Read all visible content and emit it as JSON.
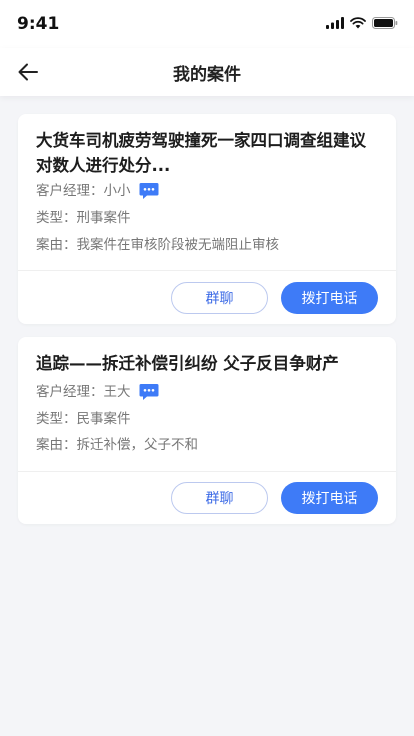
{
  "status_bar": {
    "time": "9:41",
    "icons": [
      "signal-icon",
      "wifi-icon",
      "battery-icon"
    ]
  },
  "nav": {
    "title": "我的案件",
    "back_icon": "arrow-left-icon"
  },
  "cases": [
    {
      "title": "大货车司机疲劳驾驶撞死一家四口调查组建议对数人进行处分...",
      "manager": "客户经理：小小",
      "type": "类型：刑事案件",
      "reason": "案由：我案件在审核阶段被无端阻止审核",
      "group_chat_label": "群聊",
      "call_label": "拨打电话"
    },
    {
      "title": "追踪——拆迁补偿引纠纷 父子反目争财产",
      "manager": "客户经理：王大",
      "type": "类型：民事案件",
      "reason": "案由：拆迁补偿，父子不和",
      "group_chat_label": "群聊",
      "call_label": "拨打电话"
    }
  ],
  "colors": {
    "accent": "#3e7bf7",
    "outline_text": "#3d6be6",
    "background": "#f4f5f8"
  }
}
